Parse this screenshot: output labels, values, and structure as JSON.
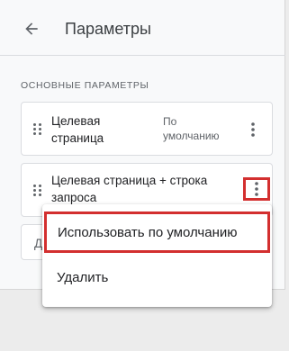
{
  "header": {
    "title": "Параметры",
    "back_icon": "arrow-back-icon"
  },
  "section": {
    "title": "ОСНОВНЫЕ ПАРАМЕТРЫ"
  },
  "params": [
    {
      "label": "Целевая страница",
      "value": "По умолчанию"
    },
    {
      "label": "Целевая страница + строка запроса",
      "value": ""
    },
    {
      "label": "Д"
    }
  ],
  "menu": {
    "items": [
      {
        "label": "Использовать по умолчанию",
        "highlighted": true
      },
      {
        "label": "Удалить"
      }
    ]
  },
  "colors": {
    "highlight": "#d32f2f",
    "background": "#ececec",
    "panel": "#f8f9fa"
  }
}
